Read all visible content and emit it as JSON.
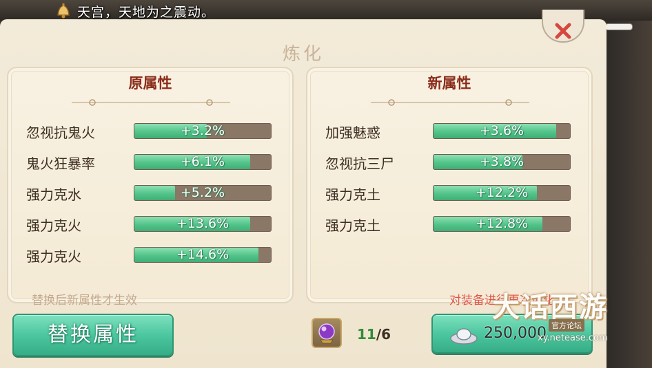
{
  "announcement": {
    "text": "天宫，天地为之震动。"
  },
  "panel": {
    "title": "炼化"
  },
  "original_attributes": {
    "header": "原属性",
    "rows": [
      {
        "label": "忽视抗鬼火",
        "value": "+3.2%",
        "fill": 0.53
      },
      {
        "label": "鬼火狂暴率",
        "value": "+6.1%",
        "fill": 0.85
      },
      {
        "label": "强力克水",
        "value": "+5.2%",
        "fill": 0.3
      },
      {
        "label": "强力克火",
        "value": "+13.6%",
        "fill": 0.85
      },
      {
        "label": "强力克火",
        "value": "+14.6%",
        "fill": 0.91
      }
    ]
  },
  "new_attributes": {
    "header": "新属性",
    "rows": [
      {
        "label": "加强魅惑",
        "value": "+3.6%",
        "fill": 0.9
      },
      {
        "label": "忽视抗三尸",
        "value": "+3.8%",
        "fill": 0.65
      },
      {
        "label": "强力克土",
        "value": "+12.2%",
        "fill": 0.76
      },
      {
        "label": "强力克土",
        "value": "+12.8%",
        "fill": 0.8
      }
    ]
  },
  "hints": {
    "left": "替换后新属性才生效",
    "right": "对装备进行再次炼化"
  },
  "replace_button": {
    "label": "替换属性"
  },
  "material": {
    "have": "11",
    "separator": "/",
    "need": "6"
  },
  "refine_button": {
    "price": "250,000",
    "icon": "silver-ingot-icon"
  },
  "watermark": {
    "logo": "大话西游",
    "sub": "官方论坛",
    "url": "xy.netease.com"
  },
  "colors": {
    "bar_fill": "#52c489",
    "bar_track": "#8a7766",
    "header": "#8b2c1a",
    "hint_right": "#e0574a",
    "count_have": "#2e8c3a"
  }
}
